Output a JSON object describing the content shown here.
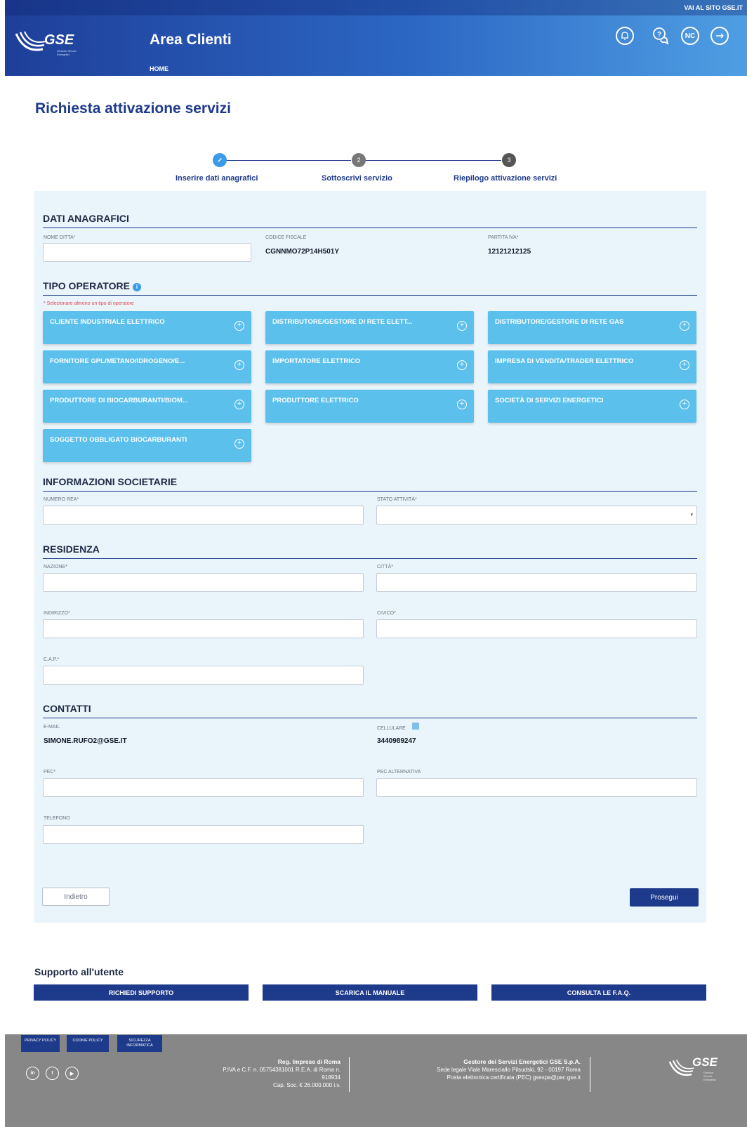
{
  "header": {
    "top_link": "VAI AL SITO GSE.IT",
    "logo_text": "GSE",
    "logo_sub": "Gestore Servizi Energetici",
    "app_title": "Area Clienti",
    "home_link": "HOME",
    "nc_badge": "NC"
  },
  "page_title": "Richiesta attivazione servizi",
  "stepper": {
    "steps": [
      {
        "num": "✓",
        "label": "Inserire dati anagrafici",
        "state": "done"
      },
      {
        "num": "2",
        "label": "Sottoscrivi servizio",
        "state": "pending"
      },
      {
        "num": "3",
        "label": "Riepilogo attivazione servizi",
        "state": "pending"
      }
    ]
  },
  "dati_anagrafici": {
    "title": "DATI ANAGRAFICI",
    "nome_ditta_label": "NOME DITTA*",
    "nome_ditta_value": "",
    "codice_fiscale_label": "CODICE FISCALE",
    "codice_fiscale_value": "CGNNMO72P14H501Y",
    "partita_iva_label": "PARTITA IVA*",
    "partita_iva_value": "12121212125"
  },
  "tipo_operatore": {
    "title": "TIPO OPERATORE",
    "info_icon": "i",
    "warning": "* Selezionare almeno un tipo di operatore",
    "options": [
      "CLIENTE INDUSTRIALE ELETTRICO",
      "DISTRIBUTORE/GESTORE DI RETE ELETT...",
      "DISTRIBUTORE/GESTORE DI RETE GAS",
      "FORNITORE GPL/METANO/IDROGENO/E...",
      "IMPORTATORE ELETTRICO",
      "IMPRESA DI VENDITA/TRADER ELETTRICO",
      "PRODUTTORE DI BIOCARBURANTI/BIOM...",
      "PRODUTTORE ELETTRICO",
      "SOCIETÀ DI SERVIZI ENERGETICI",
      "SOGGETTO OBBLIGATO BIOCARBURANTI"
    ]
  },
  "informazioni_societarie": {
    "title": "INFORMAZIONI SOCIETARIE",
    "numero_rea_label": "NUMERO REA*",
    "stato_attivita_label": "STATO ATTIVITÀ*"
  },
  "residenza": {
    "title": "RESIDENZA",
    "nazione_label": "NAZIONE*",
    "citta_label": "CITTÀ*",
    "indirizzo_label": "INDIRIZZO*",
    "civico_label": "CIVICO*",
    "cap_label": "C.A.P.*"
  },
  "contatti": {
    "title": "CONTATTI",
    "email_label": "E-MAIL",
    "email_value": "SIMONE.RUFO2@GSE.IT",
    "cellulare_label": "CELLULARE",
    "cellulare_value": "3440989247",
    "pec_label": "PEC*",
    "pec_alt_label": "PEC ALTERNATIVA",
    "telefono_label": "TELEFONO"
  },
  "actions": {
    "back": "Indietro",
    "next": "Prosegui"
  },
  "support": {
    "title": "Supporto all'utente",
    "buttons": [
      "RICHIEDI SUPPORTO",
      "SCARICA IL MANUALE",
      "CONSULTA LE F.A.Q."
    ]
  },
  "footer": {
    "links": [
      "PRIVACY POLICY",
      "COOKIE POLICY",
      "SICUREZZA INFORMATICA"
    ],
    "social": [
      "in",
      "t",
      "▶"
    ],
    "reg_title": "Reg. Imprese di Roma",
    "reg_line1": "P.IVA e C.F. n. 05754381001 R.E.A. di Roma n.",
    "reg_line2": "918934",
    "reg_line3": "Cap. Soc. € 26.000.000 i.v.",
    "company_title": "Gestore dei Servizi Energetici GSE S.p.A.",
    "company_line1": "Sede legale Viale Maresciallo Pilsudski, 92 - 00197 Roma",
    "company_line2": "Posta elettronica certificata (PEC) gsespa@pec.gse.it",
    "logo_text": "GSE",
    "logo_sub": "Gestore Servizi Energetici"
  }
}
